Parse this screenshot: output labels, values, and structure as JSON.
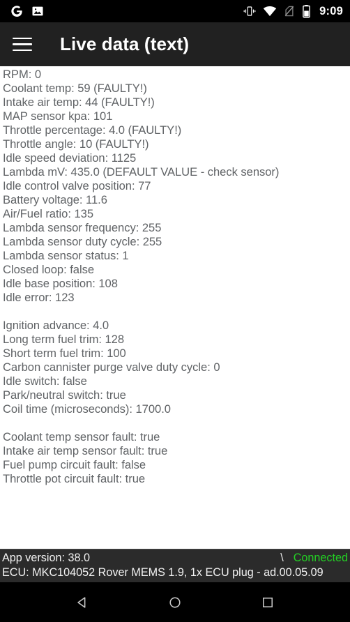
{
  "status_bar": {
    "left_icons": [
      {
        "name": "google-icon",
        "label": "G"
      },
      {
        "name": "photo-icon",
        "label": "image"
      }
    ],
    "right_icons": [
      {
        "name": "vibrate-icon",
        "label": "vibrate"
      },
      {
        "name": "wifi-icon",
        "label": "wifi"
      },
      {
        "name": "no-sim-icon",
        "label": "no sim"
      },
      {
        "name": "battery-icon",
        "label": "battery"
      }
    ],
    "clock": "9:09"
  },
  "toolbar": {
    "menu_label": "Menu",
    "title": "Live data (text)"
  },
  "live_data": {
    "lines": [
      "RPM: 0",
      "Coolant temp: 59 (FAULTY!)",
      "Intake air temp: 44 (FAULTY!)",
      "MAP sensor kpa: 101",
      "Throttle percentage: 4.0 (FAULTY!)",
      "Throttle angle: 10 (FAULTY!)",
      "Idle speed deviation: 1125",
      "Lambda mV: 435.0 (DEFAULT VALUE - check sensor)",
      "Idle control valve position: 77",
      "Battery voltage: 11.6",
      "Air/Fuel ratio: 135",
      "Lambda sensor frequency: 255",
      "Lambda sensor duty cycle: 255",
      "Lambda sensor status: 1",
      "Closed loop: false",
      "Idle base position: 108",
      "Idle error: 123",
      "",
      "Ignition advance: 4.0",
      "Long term fuel trim: 128",
      "Short term fuel trim: 100",
      "Carbon cannister purge valve duty cycle: 0",
      "Idle switch: false",
      "Park/neutral switch: true",
      "Coil time (microseconds): 1700.0",
      "",
      "Coolant temp sensor fault: true",
      "Intake air temp sensor fault: true",
      "Fuel pump circuit fault: false",
      "Throttle pot circuit fault: true"
    ]
  },
  "bottom_panel": {
    "app_version": "App version: 38.0",
    "spinner": "\\",
    "connection_status": "Connected",
    "connection_color": "#23d024",
    "ecu_info": "ECU: MKC104052 Rover MEMS 1.9, 1x ECU plug - ad.00.05.09"
  },
  "nav_bar": {
    "back_label": "Back",
    "home_label": "Home",
    "recents_label": "Recents"
  }
}
